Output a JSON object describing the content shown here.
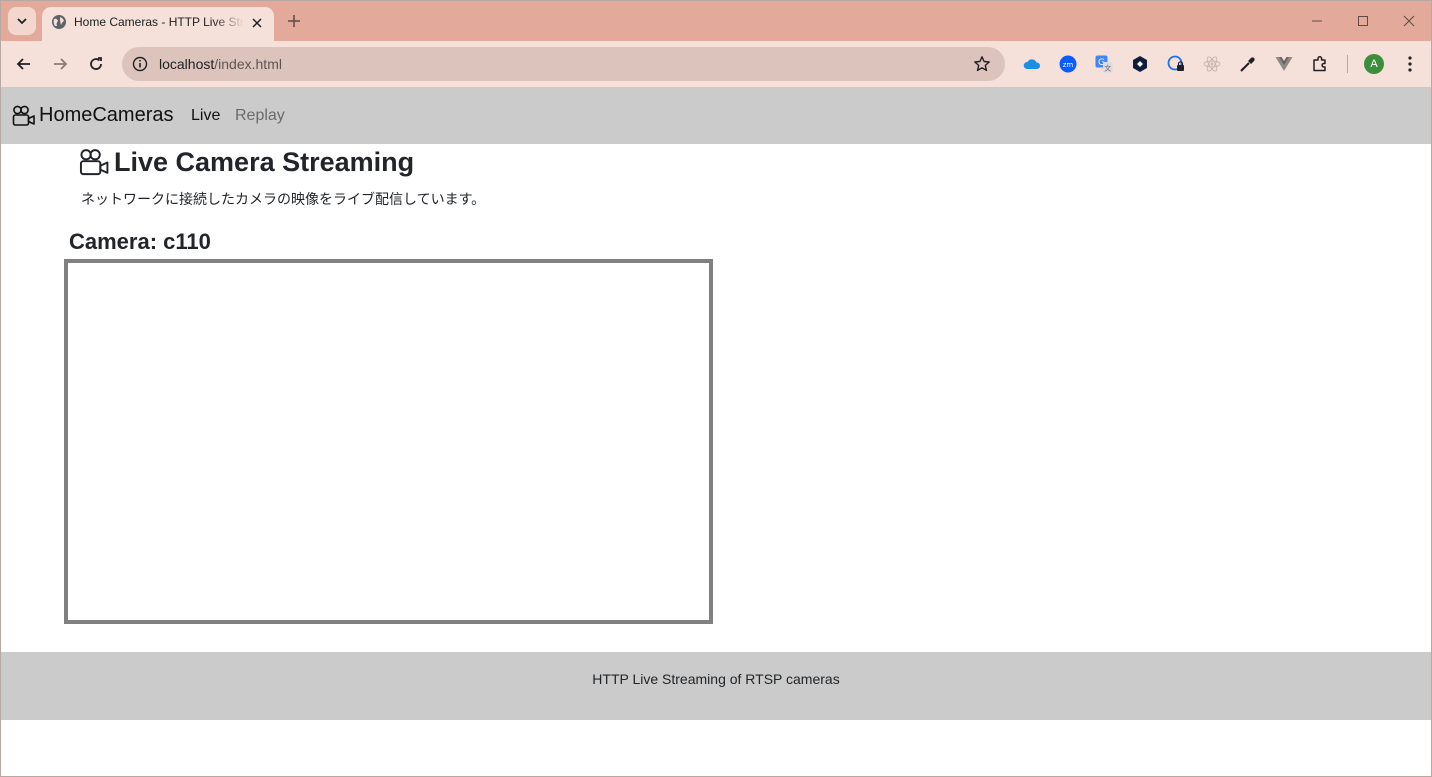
{
  "browser": {
    "tab_title": "Home Cameras - HTTP Live Streaming",
    "url_host": "localhost",
    "url_path": "/index.html",
    "profile_initial": "A",
    "extensions": [
      "cloud-icon",
      "zoom-icon",
      "translate-icon",
      "hex-icon",
      "lock-ring-icon",
      "react-icon",
      "eyedropper-icon",
      "vuejs-icon",
      "puzzle-icon"
    ]
  },
  "navbar": {
    "brand": "HomeCameras",
    "links": [
      {
        "label": "Live",
        "active": true
      },
      {
        "label": "Replay",
        "active": false
      }
    ]
  },
  "page": {
    "title": "Live Camera Streaming",
    "lead": "ネットワークに接続したカメラの映像をライブ配信しています。",
    "camera_title": "Camera: c110"
  },
  "footer": {
    "text": "HTTP Live Streaming of RTSP cameras"
  },
  "colors": {
    "tabstrip": "#e3a99a",
    "toolbar": "#f6e0da",
    "navbar": "#cbcbcb",
    "video_border": "#808080"
  }
}
